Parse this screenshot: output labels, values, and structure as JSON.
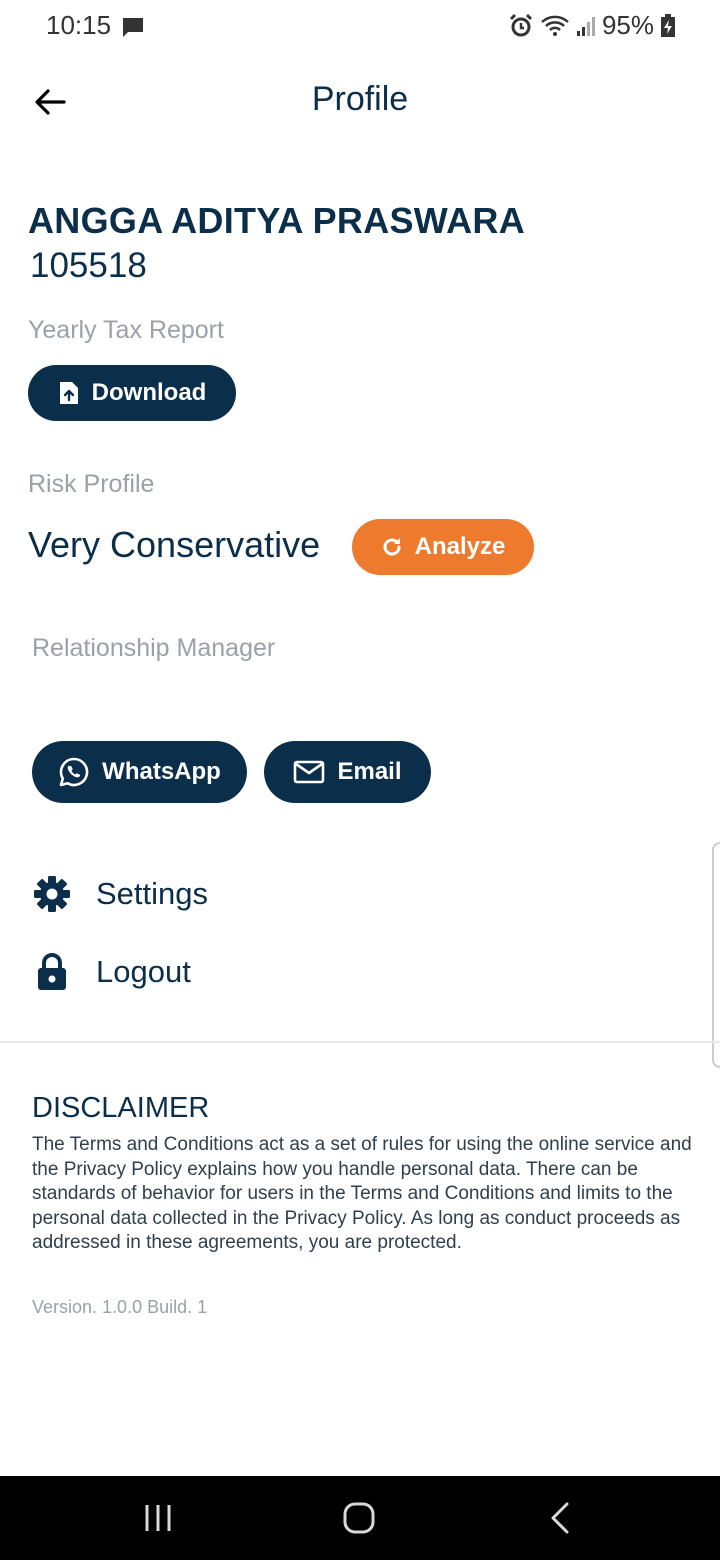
{
  "status_bar": {
    "time": "10:15",
    "battery": "95%",
    "icons": [
      "message-icon",
      "alarm-icon",
      "wifi-icon",
      "signal-icon",
      "battery-charging-icon"
    ]
  },
  "header": {
    "title": "Profile",
    "back_icon": "arrow-left-icon"
  },
  "user": {
    "name": "ANGGA ADITYA PRASWARA",
    "id": "105518"
  },
  "tax_report": {
    "label": "Yearly Tax Report",
    "button_label": "Download",
    "button_icon": "file-upload-icon"
  },
  "risk_profile": {
    "label": "Risk Profile",
    "value": "Very Conservative",
    "button_label": "Analyze",
    "button_icon": "refresh-icon"
  },
  "relationship_manager": {
    "label": "Relationship Manager",
    "whatsapp_label": "WhatsApp",
    "email_label": "Email"
  },
  "menu": {
    "settings_label": "Settings",
    "logout_label": "Logout"
  },
  "disclaimer": {
    "title": "DISCLAIMER",
    "text": "The Terms and Conditions act as a set of rules for using the online service and the Privacy Policy explains how you handle personal data. There can be standards of behavior for users in the Terms and Conditions and limits to the personal data collected in the Privacy Policy. As long as conduct proceeds as addressed in these agreements, you are protected."
  },
  "version": "Version. 1.0.0 Build. 1",
  "colors": {
    "primary": "#0b2e4a",
    "accent": "#ee7a2d",
    "muted": "#9aa1a8"
  },
  "nav_bar": {
    "buttons": [
      "recents-icon",
      "home-icon",
      "back-icon"
    ]
  }
}
